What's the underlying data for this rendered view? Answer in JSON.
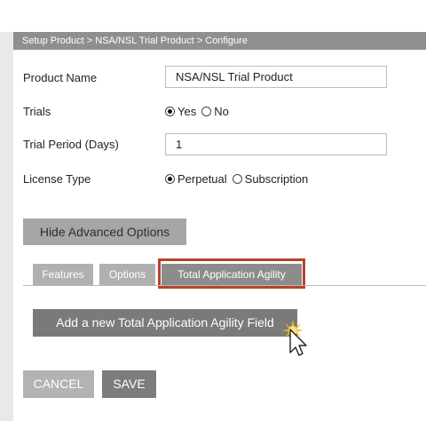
{
  "breadcrumb": "Setup Product > NSA/NSL Trial Product > Configure",
  "form": {
    "product_name": {
      "label": "Product Name",
      "value": "NSA/NSL Trial Product"
    },
    "trials": {
      "label": "Trials",
      "options": [
        "Yes",
        "No"
      ],
      "selected": "Yes"
    },
    "trial_period": {
      "label": "Trial Period (Days)",
      "value": "1"
    },
    "license_type": {
      "label": "License Type",
      "options": [
        "Perpetual",
        "Subscription"
      ],
      "selected": "Perpetual"
    }
  },
  "advanced_button": "Hide Advanced Options",
  "tabs": [
    {
      "label": "Features",
      "active": false
    },
    {
      "label": "Options",
      "active": false
    },
    {
      "label": "Total Application Agility",
      "active": true
    }
  ],
  "add_field_button": "Add a new Total Application Agility Field",
  "actions": {
    "cancel": "CANCEL",
    "save": "SAVE"
  },
  "colors": {
    "highlight": "#b5432b",
    "cursor_glow": "#f5b21a"
  },
  "icons": {
    "cursor": "pointer-arrow-icon"
  }
}
